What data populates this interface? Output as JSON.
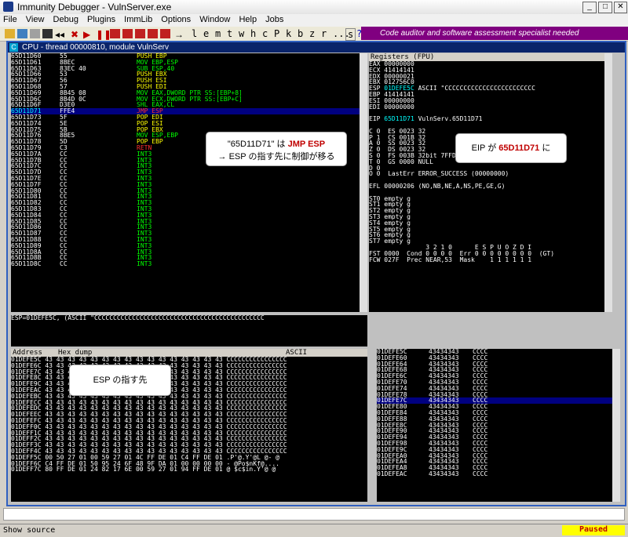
{
  "window": {
    "title": "Immunity Debugger - VulnServer.exe",
    "minimize": "_",
    "maximize": "□",
    "close": "✕"
  },
  "menu": [
    "File",
    "View",
    "Debug",
    "Plugins",
    "ImmLib",
    "Options",
    "Window",
    "Help",
    "Jobs"
  ],
  "toolbar_letters": [
    "l",
    "e",
    "m",
    "t",
    "w",
    "h",
    "c",
    "P",
    "k",
    "b",
    "z",
    "r",
    "...",
    "s",
    "?"
  ],
  "banner": "Code auditor and software assessment specialist needed",
  "cpu_title": "CPU - thread 00000810, module VulnServ",
  "disasm": [
    {
      "addr": "65D11D60",
      "hex": "55",
      "ins": "PUSH EBP",
      "cls": "yellow"
    },
    {
      "addr": "65D11D61",
      "hex": "8BEC",
      "ins": "MOV EBP,ESP",
      "cls": "green"
    },
    {
      "addr": "65D11D63",
      "hex": "83EC 40",
      "ins": "SUB ESP,40",
      "cls": "green"
    },
    {
      "addr": "65D11D66",
      "hex": "53",
      "ins": "PUSH EBX",
      "cls": "yellow"
    },
    {
      "addr": "65D11D67",
      "hex": "56",
      "ins": "PUSH ESI",
      "cls": "yellow"
    },
    {
      "addr": "65D11D68",
      "hex": "57",
      "ins": "PUSH EDI",
      "cls": "yellow"
    },
    {
      "addr": "65D11D69",
      "hex": "8B45 08",
      "ins": "MOV EAX,DWORD PTR SS:[EBP+8]",
      "cls": "green"
    },
    {
      "addr": "65D11D6C",
      "hex": "8B4D 0C",
      "ins": "MOV ECX,DWORD PTR SS:[EBP+C]",
      "cls": "green"
    },
    {
      "addr": "65D11D6F",
      "hex": "D3E0",
      "ins": "SHL EAX,CL",
      "cls": "green"
    },
    {
      "addr": "65D11D71",
      "hex": "FFE4",
      "ins": "JMP ESP",
      "cls": "red",
      "sel": true
    },
    {
      "addr": "65D11D73",
      "hex": "5F",
      "ins": "POP EDI",
      "cls": "yellow"
    },
    {
      "addr": "65D11D74",
      "hex": "5E",
      "ins": "POP ESI",
      "cls": "yellow"
    },
    {
      "addr": "65D11D75",
      "hex": "5B",
      "ins": "POP EBX",
      "cls": "yellow"
    },
    {
      "addr": "65D11D76",
      "hex": "8BE5",
      "ins": "MOV ESP,EBP",
      "cls": "green"
    },
    {
      "addr": "65D11D78",
      "hex": "5D",
      "ins": "POP EBP",
      "cls": "yellow"
    },
    {
      "addr": "65D11D79",
      "hex": "C3",
      "ins": "RETN",
      "cls": "red"
    },
    {
      "addr": "65D11D7A",
      "hex": "CC",
      "ins": "INT3",
      "cls": "green"
    },
    {
      "addr": "65D11D7B",
      "hex": "CC",
      "ins": "INT3",
      "cls": "green"
    },
    {
      "addr": "65D11D7C",
      "hex": "CC",
      "ins": "INT3",
      "cls": "green"
    },
    {
      "addr": "65D11D7D",
      "hex": "CC",
      "ins": "INT3",
      "cls": "green"
    },
    {
      "addr": "65D11D7E",
      "hex": "CC",
      "ins": "INT3",
      "cls": "green"
    },
    {
      "addr": "65D11D7F",
      "hex": "CC",
      "ins": "INT3",
      "cls": "green"
    },
    {
      "addr": "65D11D80",
      "hex": "CC",
      "ins": "INT3",
      "cls": "green"
    },
    {
      "addr": "65D11D81",
      "hex": "CC",
      "ins": "INT3",
      "cls": "green"
    },
    {
      "addr": "65D11D82",
      "hex": "CC",
      "ins": "INT3",
      "cls": "green"
    },
    {
      "addr": "65D11D83",
      "hex": "CC",
      "ins": "INT3",
      "cls": "green"
    },
    {
      "addr": "65D11D84",
      "hex": "CC",
      "ins": "INT3",
      "cls": "green"
    },
    {
      "addr": "65D11D85",
      "hex": "CC",
      "ins": "INT3",
      "cls": "green"
    },
    {
      "addr": "65D11D86",
      "hex": "CC",
      "ins": "INT3",
      "cls": "green"
    },
    {
      "addr": "65D11D87",
      "hex": "CC",
      "ins": "INT3",
      "cls": "green"
    },
    {
      "addr": "65D11D88",
      "hex": "CC",
      "ins": "INT3",
      "cls": "green"
    },
    {
      "addr": "65D11D89",
      "hex": "CC",
      "ins": "INT3",
      "cls": "green"
    },
    {
      "addr": "65D11D8A",
      "hex": "CC",
      "ins": "INT3",
      "cls": "green"
    },
    {
      "addr": "65D11D8B",
      "hex": "CC",
      "ins": "INT3",
      "cls": "green"
    },
    {
      "addr": "65D11D8C",
      "hex": "CC",
      "ins": "INT3",
      "cls": "green"
    }
  ],
  "info_line": "ESP=01DEFE5C, (ASCII \"CCCCCCCCCCCCCCCCCCCCCCCCCCCCCCCCCCCCCCCCCCCCC",
  "registers_title": "Registers (FPU)",
  "registers": [
    "EAX 00000000",
    "ECX 41414141",
    "EDX 00000021",
    "EBX 012756C0",
    "ESP 01DEFE5C ASCII \"CCCCCCCCCCCCCCCCCCCCCCCC",
    "EBP 41414141",
    "ESI 00000000",
    "EDI 00000000",
    "",
    "EIP 65D11D71 VulnServ.65D11D71",
    "",
    "C 0  ES 0023 32",
    "P 1  CS 001B 32",
    "A 0  SS 0023 32",
    "Z 0  DS 0023 32",
    "S 0  FS 003B 32bit 7FFDC000(FFF)",
    "T 0  GS 0000 NULL",
    "D 0",
    "O 0  LastErr ERROR_SUCCESS (00000000)",
    "",
    "EFL 00000206 (NO,NB,NE,A,NS,PE,GE,G)",
    "",
    "ST0 empty g",
    "ST1 empty g",
    "ST2 empty g",
    "ST3 empty g",
    "ST4 empty g",
    "ST5 empty g",
    "ST6 empty g",
    "ST7 empty g",
    "               3 2 1 0      E S P U O Z D I",
    "FST 0000  Cond 0 0 0 0  Err 0 0 0 0 0 0 0 0  (GT)",
    "FCW 027F  Prec NEAR,53  Mask    1 1 1 1 1 1"
  ],
  "dump_headers": {
    "address": "Address",
    "hex": "Hex dump",
    "ascii": "ASCII"
  },
  "dump": [
    "01DEFE5C 43 43 43 43 43 43 43 43 43 43 43 43 43 43 43 43 CCCCCCCCCCCCCCCC",
    "01DEFE6C 43 43 43 43 43 43 43 43 43 43 43 43 43 43 43 43 CCCCCCCCCCCCCCCC",
    "01DEFE7C 43 43 43 43 43 43 43 43 43 43 43 43 43 43 43 43 CCCCCCCCCCCCCCCC",
    "01DEFE8C 43 43 43 43 43 43 43 43 43 43 43 43 43 43 43 43 CCCCCCCCCCCCCCCC",
    "01DEFE9C 43 43 43 43 43 43 43 43 43 43 43 43 43 43 43 43 CCCCCCCCCCCCCCCC",
    "01DEFEAC 43 43 43 43 43 43 43 43 43 43 43 43 43 43 43 43 CCCCCCCCCCCCCCCC",
    "01DEFEBC 43 43 43 43 43 43 43 43 43 43 43 43 43 43 43 43 CCCCCCCCCCCCCCCC",
    "01DEFECC 43 43 43 43 43 43 43 43 43 43 43 43 43 43 43 43 CCCCCCCCCCCCCCCC",
    "01DEFEDC 43 43 43 43 43 43 43 43 43 43 43 43 43 43 43 43 CCCCCCCCCCCCCCCC",
    "01DEFEEC 43 43 43 43 43 43 43 43 43 43 43 43 43 43 43 43 CCCCCCCCCCCCCCCC",
    "01DEFEFC 43 43 43 43 43 43 43 43 43 43 43 43 43 43 43 43 CCCCCCCCCCCCCCCC",
    "01DEFF0C 43 43 43 43 43 43 43 43 43 43 43 43 43 43 43 43 CCCCCCCCCCCCCCCC",
    "01DEFF1C 43 43 43 43 43 43 43 43 43 43 43 43 43 43 43 43 CCCCCCCCCCCCCCCC",
    "01DEFF2C 43 43 43 43 43 43 43 43 43 43 43 43 43 43 43 43 CCCCCCCCCCCCCCCC",
    "01DEFF3C 43 43 43 43 43 43 43 43 43 43 43 43 43 43 43 43 CCCCCCCCCCCCCCCC",
    "01DEFF4C 43 43 43 43 43 43 43 43 43 43 43 43 43 43 43 43 CCCCCCCCCCCCCCCC",
    "01DEFF5C 00 50 27 01 00 59 27 01 4C FF DE 01 C4 FF DE 01 .P'@.Y'@L @- @",
    "01DEFF6C C4 FF DE 01 50 95 24 6F 48 9F DA 01 00 00 00 00 - @Po$nKf@....",
    "01DEFF7C 80 FF DE 01 24 82 17 6E 00 59 27 01 94 FF DE 01 @ $c$in.Y'@ @"
  ],
  "stack": [
    {
      "addr": "01DEFE5C",
      "val": "43434343",
      "asc": "CCCC"
    },
    {
      "addr": "01DEFE60",
      "val": "43434343",
      "asc": "CCCC"
    },
    {
      "addr": "01DEFE64",
      "val": "43434343",
      "asc": "CCCC"
    },
    {
      "addr": "01DEFE68",
      "val": "43434343",
      "asc": "CCCC"
    },
    {
      "addr": "01DEFE6C",
      "val": "43434343",
      "asc": "CCCC"
    },
    {
      "addr": "01DEFE70",
      "val": "43434343",
      "asc": "CCCC"
    },
    {
      "addr": "01DEFE74",
      "val": "43434343",
      "asc": "CCCC"
    },
    {
      "addr": "01DEFE78",
      "val": "43434343",
      "asc": "CCCC"
    },
    {
      "addr": "01DEFE7C",
      "val": "43434343",
      "asc": "CCCC",
      "sel": true
    },
    {
      "addr": "01DEFE80",
      "val": "43434343",
      "asc": "CCCC"
    },
    {
      "addr": "01DEFE84",
      "val": "43434343",
      "asc": "CCCC"
    },
    {
      "addr": "01DEFE88",
      "val": "43434343",
      "asc": "CCCC"
    },
    {
      "addr": "01DEFE8C",
      "val": "43434343",
      "asc": "CCCC"
    },
    {
      "addr": "01DEFE90",
      "val": "43434343",
      "asc": "CCCC"
    },
    {
      "addr": "01DEFE94",
      "val": "43434343",
      "asc": "CCCC"
    },
    {
      "addr": "01DEFE98",
      "val": "43434343",
      "asc": "CCCC"
    },
    {
      "addr": "01DEFE9C",
      "val": "43434343",
      "asc": "CCCC"
    },
    {
      "addr": "01DEFEA0",
      "val": "43434343",
      "asc": "CCCC"
    },
    {
      "addr": "01DEFEA4",
      "val": "43434343",
      "asc": "CCCC"
    },
    {
      "addr": "01DEFEA8",
      "val": "43434343",
      "asc": "CCCC"
    },
    {
      "addr": "01DEFEAC",
      "val": "43434343",
      "asc": "CCCC"
    }
  ],
  "callouts": {
    "jmp_esp_line1_a": "\"65D11D71\" は ",
    "jmp_esp_line1_b": "JMP ESP",
    "jmp_esp_line2": "→ ESP の指す先に制御が移る",
    "eip_a": "EIP が ",
    "eip_b": "65D11D71",
    "eip_c": " に",
    "esp": "ESP の指す先"
  },
  "status": {
    "left": "Show source",
    "right": "Paused"
  }
}
